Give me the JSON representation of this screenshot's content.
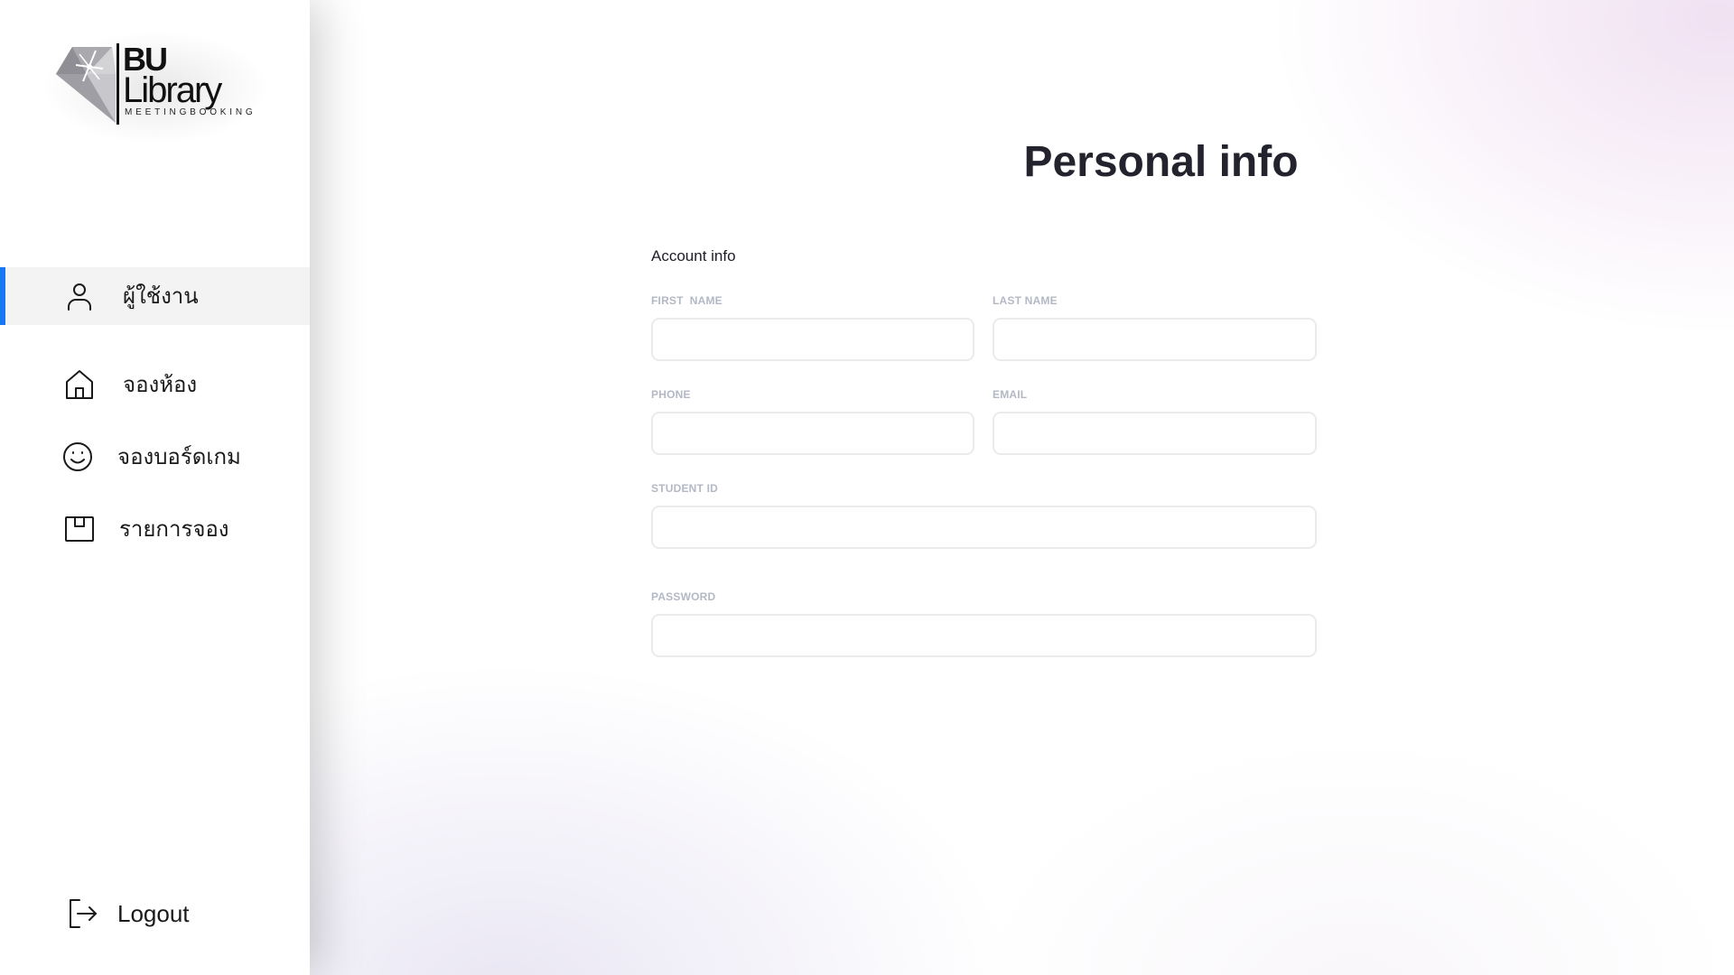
{
  "brand": {
    "logo_line1": "BU",
    "logo_line2": "Library",
    "logo_sub": "MEETINGBOOKING"
  },
  "sidebar": {
    "accent_color": "#1877f2",
    "items": [
      {
        "label": "ผู้ใช้งาน",
        "icon": "user-icon",
        "active": true
      },
      {
        "label": "จองห้อง",
        "icon": "home-icon",
        "active": false
      },
      {
        "label": "จองบอร์ดเกม",
        "icon": "smile-icon",
        "active": false
      },
      {
        "label": "รายการจอง",
        "icon": "box-icon",
        "active": false
      }
    ],
    "logout": {
      "label": "Logout",
      "icon": "logout-icon"
    }
  },
  "main": {
    "title": "Personal info",
    "section_title": "Account info",
    "fields": {
      "first_name": {
        "label": "FIRST  NAME",
        "value": ""
      },
      "last_name": {
        "label": "LAST NAME",
        "value": ""
      },
      "phone": {
        "label": "PHONE",
        "value": ""
      },
      "email": {
        "label": "EMAIL",
        "value": ""
      },
      "student_id": {
        "label": "STUDENT ID",
        "value": ""
      },
      "password": {
        "label": "PASSWORD",
        "value": ""
      }
    }
  }
}
